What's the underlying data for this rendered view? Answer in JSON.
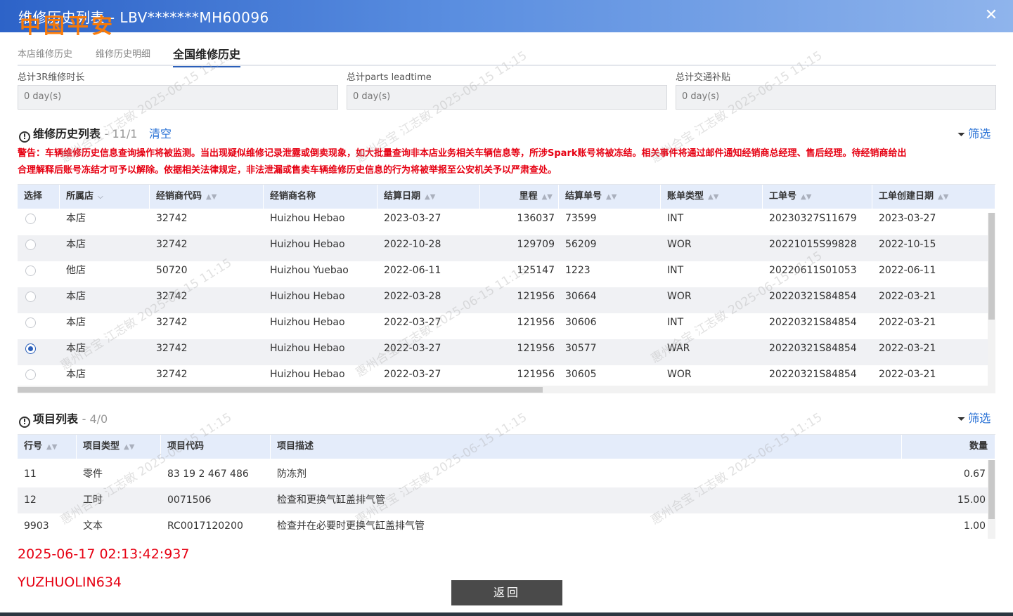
{
  "window": {
    "title": "维修历史列表 - LBV*******MH60096",
    "logo_text": "中国平安",
    "close_label": "✕"
  },
  "tabs": [
    "本店维修历史",
    "维修历史明细",
    "全国维修历史"
  ],
  "active_tab": "全国维修历史",
  "summary": [
    {
      "label": "总计3R维修时长",
      "value": "0 day(s)"
    },
    {
      "label": "总计parts leadtime",
      "value": "0 day(s)"
    },
    {
      "label": "总计交通补贴",
      "value": "0 day(s)"
    }
  ],
  "history": {
    "title": "维修历史列表",
    "count": "- 11/1",
    "clear_label": "清空",
    "filter_label": "筛选",
    "warning_line1": "警告：车辆维修历史信息查询操作将被监测。当出现疑似维修记录泄露或倒卖现象，如大批量查询非本店业务相关车辆信息等，所涉Spark账号将被冻结。相关事件将通过邮件通知经销商总经理、售后经理。待经销商给出",
    "warning_line2": "合理解释后账号冻结才可予以解除。依据相关法律规定，非法泄漏或售卖车辆维修历史信息的行为将被举报至公安机关予以严肃查处。",
    "columns": [
      "选择",
      "所属店",
      "经销商代码",
      "经销商名称",
      "结算日期",
      "里程",
      "结算单号",
      "账单类型",
      "工单号",
      "工单创建日期"
    ],
    "rows": [
      {
        "selected": false,
        "store": "本店",
        "dealer_code": "32742",
        "dealer_name": "Huizhou Hebao",
        "settle_date": "2023-03-27",
        "mileage": "136037",
        "settle_no": "73599",
        "bill_type": "INT",
        "order_no": "20230327S11679",
        "order_date": "2023-03-27"
      },
      {
        "selected": false,
        "store": "本店",
        "dealer_code": "32742",
        "dealer_name": "Huizhou Hebao",
        "settle_date": "2022-10-28",
        "mileage": "129709",
        "settle_no": "56209",
        "bill_type": "WOR",
        "order_no": "20221015S99828",
        "order_date": "2022-10-15"
      },
      {
        "selected": false,
        "store": "他店",
        "dealer_code": "50720",
        "dealer_name": "Huizhou Yuebao",
        "settle_date": "2022-06-11",
        "mileage": "125147",
        "settle_no": "1223",
        "bill_type": "INT",
        "order_no": "20220611S01053",
        "order_date": "2022-06-11"
      },
      {
        "selected": false,
        "store": "本店",
        "dealer_code": "32742",
        "dealer_name": "Huizhou Hebao",
        "settle_date": "2022-03-28",
        "mileage": "121956",
        "settle_no": "30664",
        "bill_type": "WOR",
        "order_no": "20220321S84854",
        "order_date": "2022-03-21"
      },
      {
        "selected": false,
        "store": "本店",
        "dealer_code": "32742",
        "dealer_name": "Huizhou Hebao",
        "settle_date": "2022-03-27",
        "mileage": "121956",
        "settle_no": "30606",
        "bill_type": "INT",
        "order_no": "20220321S84854",
        "order_date": "2022-03-21"
      },
      {
        "selected": true,
        "store": "本店",
        "dealer_code": "32742",
        "dealer_name": "Huizhou Hebao",
        "settle_date": "2022-03-27",
        "mileage": "121956",
        "settle_no": "30577",
        "bill_type": "WAR",
        "order_no": "20220321S84854",
        "order_date": "2022-03-21"
      },
      {
        "selected": false,
        "store": "本店",
        "dealer_code": "32742",
        "dealer_name": "Huizhou Hebao",
        "settle_date": "2022-03-27",
        "mileage": "121956",
        "settle_no": "30605",
        "bill_type": "WOR",
        "order_no": "20220321S84854",
        "order_date": "2022-03-21"
      }
    ]
  },
  "items": {
    "title": "项目列表",
    "count": "- 4/0",
    "filter_label": "筛选",
    "columns": [
      "行号",
      "项目类型",
      "项目代码",
      "项目描述",
      "数量"
    ],
    "rows": [
      {
        "line": "11",
        "type": "零件",
        "code": "83 19 2 467 486",
        "desc": "防冻剂",
        "qty": "0.67"
      },
      {
        "line": "12",
        "type": "工时",
        "code": "0071506",
        "desc": "检查和更换气缸盖排气管",
        "qty": "15.00"
      },
      {
        "line": "9903",
        "type": "文本",
        "code": "RC0017120200",
        "desc": "检查并在必要时更换气缸盖排气管",
        "qty": "1.00"
      }
    ]
  },
  "stamp": {
    "timestamp": "2025-06-17 02:13:42:937",
    "user": "YUZHUOLIN634"
  },
  "back_label": "返回",
  "watermark_text": "惠州合宝  江志敏  2025-06-15 11:15",
  "colors": {
    "accent": "#2b5fb9",
    "header_bg": "#e4ecfa",
    "warning": "#e60012",
    "logo": "#ff7a00"
  }
}
